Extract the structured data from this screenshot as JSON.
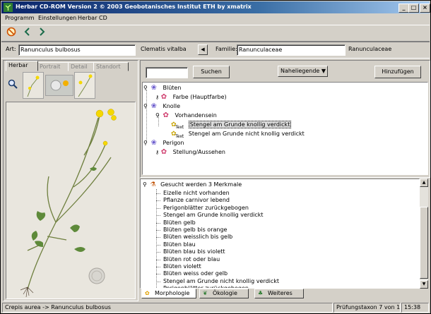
{
  "window": {
    "title": "Herbar CD-ROM Version 2 © 2003 Geobotanisches Institut ETH  by  xmatrix",
    "buttons": {
      "minimize": "_",
      "maximize": "□",
      "close": "×"
    }
  },
  "menu": [
    "Programm",
    "Einstellungen",
    "Herbar CD"
  ],
  "art": {
    "label": "Art:",
    "value": "Ranunculus bulbosus",
    "compare": "Clematis vitalba",
    "arrow": "◀"
  },
  "familie": {
    "label": "Familie:",
    "value": "Ranunculaceae",
    "compare": "Ranunculaceae"
  },
  "left_tabs": [
    "Herbar",
    "Portrait",
    "Detail",
    "Standort"
  ],
  "search": {
    "value": "",
    "button": "Suchen",
    "sort_select": "Naheliegende",
    "add_button": "Hinzufügen"
  },
  "tree1": [
    {
      "level": 0,
      "label": "Blüten"
    },
    {
      "level": 1,
      "label": "Farbe (Hauptfarbe)"
    },
    {
      "level": 0,
      "label": "Knolle"
    },
    {
      "level": 1,
      "label": "Vorhandensein"
    },
    {
      "level": 2,
      "label": "Stengel am Grunde knollig verdickt",
      "selected": true
    },
    {
      "level": 2,
      "label": "Stengel am Grunde nicht knollig verdickt"
    },
    {
      "level": 0,
      "label": "Perigon"
    },
    {
      "level": 1,
      "label": "Stellung/Aussehen"
    }
  ],
  "text_badge": "Text",
  "tree2": {
    "header": "Gesucht werden 3 Merkmale",
    "items": [
      "Eizelle nicht vorhanden",
      "Pflanze carnivor lebend",
      "Perigonblätter zurückgebogen",
      "Stengel am Grunde knollig verdickt",
      "Blüten gelb",
      "Blüten gelb bis orange",
      "Blüten weisslich bis gelb",
      "Blüten blau",
      "Blüten blau bis violett",
      "Blüten rot oder blau",
      "Blüten violett",
      "Blüten weiss oder gelb",
      "Stengel am Grunde nicht knollig verdickt",
      "Perigonblätter zurückgebogen"
    ]
  },
  "bottom_tabs": [
    "Morphologie",
    "Ökologie",
    "Weiteres"
  ],
  "status": {
    "left": "Crepis aurea -> Ranunculus bulbosus",
    "middle": "Prüfungstaxon 7 von 10",
    "time": "15:38"
  },
  "colors": {
    "title_start": "#0a246a",
    "title_end": "#a6caf0",
    "flower": "#f5d800",
    "face": "#d4d0c8"
  }
}
